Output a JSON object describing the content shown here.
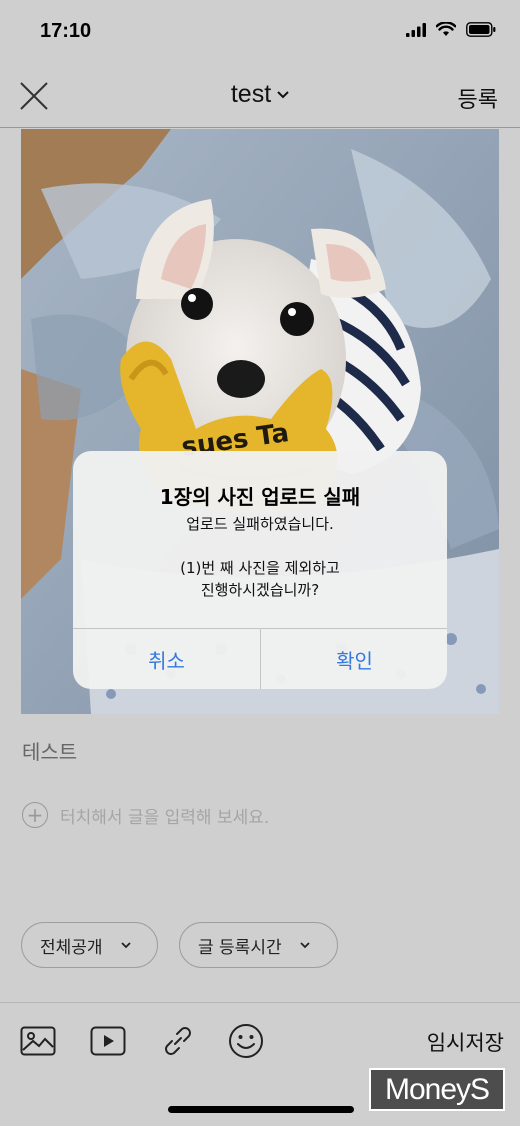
{
  "status": {
    "time": "17:10"
  },
  "header": {
    "title": "test",
    "register_label": "등록"
  },
  "post": {
    "caption": "테스트",
    "add_placeholder": "터치해서 글을 입력해 보세요.",
    "toy_text": "sues Ta"
  },
  "options": {
    "visibility": "전체공개",
    "post_time": "글 등록시간"
  },
  "toolbar": {
    "temp_save_label": "임시저장",
    "icons": [
      "image-icon",
      "video-icon",
      "link-icon",
      "emoji-icon"
    ]
  },
  "dialog": {
    "title": "1장의 사진 업로드 실패",
    "message": "업로드 실패하였습니다.\n\n(1)번 째 사진을 제외하고\n진행하시겠습니까?",
    "cancel_label": "취소",
    "confirm_label": "확인"
  },
  "watermark": {
    "text": "MoneyS"
  },
  "colors": {
    "accent_line": "#c88a5a",
    "dialog_button": "#3478e0",
    "dim_background": "#cfcfcf"
  }
}
